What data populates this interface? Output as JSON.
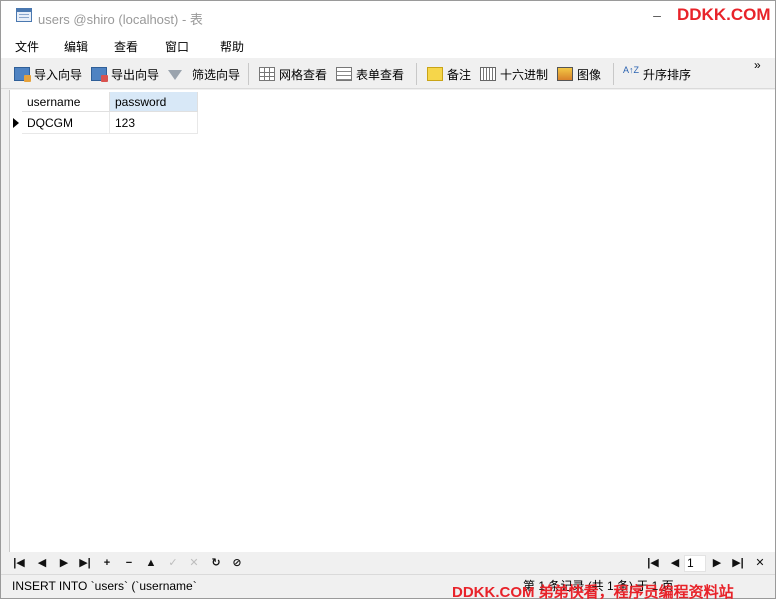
{
  "window": {
    "title": "users @shiro (localhost) - 表",
    "minimize_glyph": "–",
    "icon": "table-window-icon"
  },
  "watermark": {
    "top": "DDKK.COM",
    "bottom": "DDKK.COM 弟弟快看，程序员编程资料站",
    "color": "#e8232a"
  },
  "menu": {
    "items": [
      "文件",
      "编辑",
      "查看",
      "窗口",
      "帮助"
    ]
  },
  "toolbar": {
    "import_wizard": "导入向导",
    "export_wizard": "导出向导",
    "filter_wizard": "筛选向导",
    "grid_view": "网格查看",
    "form_view": "表单查看",
    "memo": "备注",
    "hex": "十六进制",
    "image": "图像",
    "sort_asc": "升序排序",
    "sort_icon_text": "A↑Z",
    "more_glyph": "»"
  },
  "grid": {
    "columns": [
      "username",
      "password"
    ],
    "rows": [
      [
        "DQCGM",
        "123"
      ]
    ],
    "active_header_color": "#d8e8f7"
  },
  "navbar": {
    "first": "|◀",
    "prev": "◀",
    "next": "▶",
    "last": "▶|",
    "add": "+",
    "delete": "−",
    "up": "▲",
    "apply": "✓",
    "cancel": "✕",
    "refresh": "↻",
    "stop": "⊘",
    "page_first": "|◀",
    "page_prev": "◀",
    "page_number": "1",
    "page_next": "▶",
    "page_last": "▶|",
    "tools": "✕"
  },
  "status": {
    "sql": "INSERT INTO `users` (`username`",
    "record_count": "第 1 条记录 (共 1 条) 于 1 页"
  }
}
